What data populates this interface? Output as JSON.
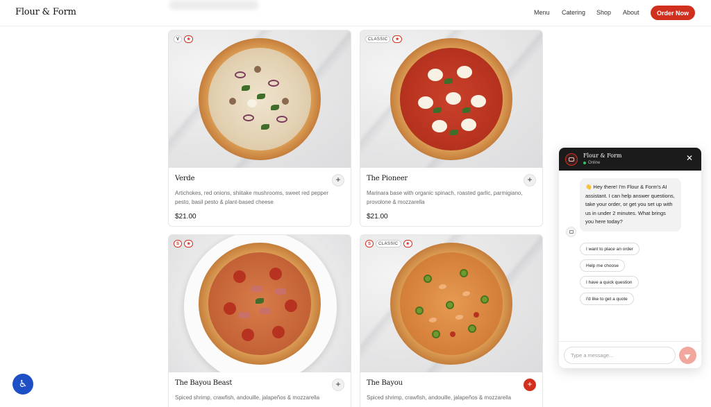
{
  "header": {
    "logo": "Flour & Form",
    "nav": [
      "Menu",
      "Catering",
      "Shop",
      "About"
    ],
    "order_button": "Order Now"
  },
  "menu_items": [
    {
      "name": "Verde",
      "description": "Artichokes, red onions, shiitake mushrooms, sweet red pepper pesto, basil pesto & plant-based cheese",
      "price": "$21.00",
      "badges": [
        "V",
        "★"
      ]
    },
    {
      "name": "The Pioneer",
      "description": "Marinara base with organic spinach, roasted garlic, parmigiano, provolone & mozzarella",
      "price": "$21.00",
      "badges": [
        "CLASSIC",
        "★"
      ]
    },
    {
      "name": "The Bayou Beast",
      "description": "Spiced shrimp, crawfish, andouille, jalapeños & mozzarella",
      "price": "",
      "badges": [
        "S",
        "★"
      ]
    },
    {
      "name": "The Bayou",
      "description": "Spiced shrimp, crawfish, andouille, jalapeños & mozzarella",
      "price": "",
      "badges": [
        "S",
        "CLASSIC",
        "★"
      ]
    }
  ],
  "add_symbol": "+",
  "chat": {
    "title": "Flour & Form",
    "status": "Online",
    "close": "✕",
    "greeting": "👋 Hey there! I'm Flour & Form's AI assistant. I can help answer questions, take your order, or get you set up with us in under 2 minutes. What brings you here today?",
    "quick_replies": [
      "I want to place an order",
      "Help me choose",
      "I have a quick question",
      "I'd like to get a quote"
    ],
    "input_placeholder": "Type a message..."
  },
  "accessibility": {
    "icon": "♿"
  },
  "colors": {
    "accent": "#d2301f",
    "chat_header": "#1b1b1b",
    "a11y": "#1e4fc4"
  }
}
